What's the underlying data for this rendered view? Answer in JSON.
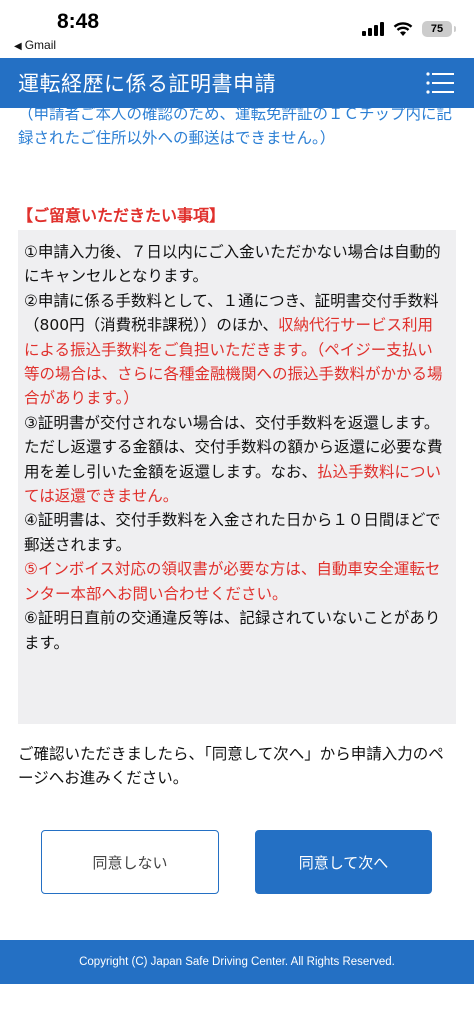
{
  "status_bar": {
    "time": "8:48",
    "back_app": "Gmail",
    "battery": "75"
  },
  "header": {
    "title": "運転経歴に係る証明書申請",
    "menu_icon": "hamburger-menu-icon"
  },
  "content": {
    "cutoff_note": "（申請者ご本人の確認のため、運転免許証のＩＣチップ内に記録されたご住所以外への郵送はできません。）",
    "notice_heading": "【ご留意いただきたい事項】",
    "notices": [
      {
        "parts": [
          {
            "text": "①申請入力後、７日以内にご入金いただかない場合は自動的にキャンセルとなります。",
            "red": false
          }
        ]
      },
      {
        "parts": [
          {
            "text": "②申請に係る手数料として、１通につき、証明書交付手数料（800円（消費税非課税））のほか、",
            "red": false
          },
          {
            "text": "収納代行サービス利用による振込手数料をご負担いただきます。（ペイジー支払い等の場合は、さらに各種金融機関への振込手数料がかかる場合があります。）",
            "red": true
          }
        ]
      },
      {
        "parts": [
          {
            "text": "③証明書が交付されない場合は、交付手数料を返還します。ただし返還する金額は、交付手数料の額から返還に必要な費用を差し引いた金額を返還します。なお、",
            "red": false
          },
          {
            "text": "払込手数料については返還できません。",
            "red": true
          }
        ]
      },
      {
        "parts": [
          {
            "text": "④証明書は、交付手数料を入金された日から１０日間ほどで郵送されます。",
            "red": false
          }
        ]
      },
      {
        "parts": [
          {
            "text": "⑤インボイス対応の領収書が必要な方は、自動車安全運転センター本部へお問い合わせください。",
            "red": true
          }
        ]
      },
      {
        "parts": [
          {
            "text": "⑥証明日直前の交通違反等は、記録されていないことがあります。",
            "red": false
          }
        ]
      }
    ],
    "confirm_text": "ご確認いただきましたら、「同意して次へ」から申請入力のページへお進みください。"
  },
  "buttons": {
    "disagree_label": "同意しない",
    "agree_label": "同意して次へ"
  },
  "footer": {
    "copyright": "Copyright (C) Japan Safe Driving Center. All Rights Reserved."
  },
  "colors": {
    "primary": "#2470c4",
    "link_blue": "#2c7fd4",
    "warning_red": "#e0302c",
    "notice_bg": "#efeff1"
  }
}
